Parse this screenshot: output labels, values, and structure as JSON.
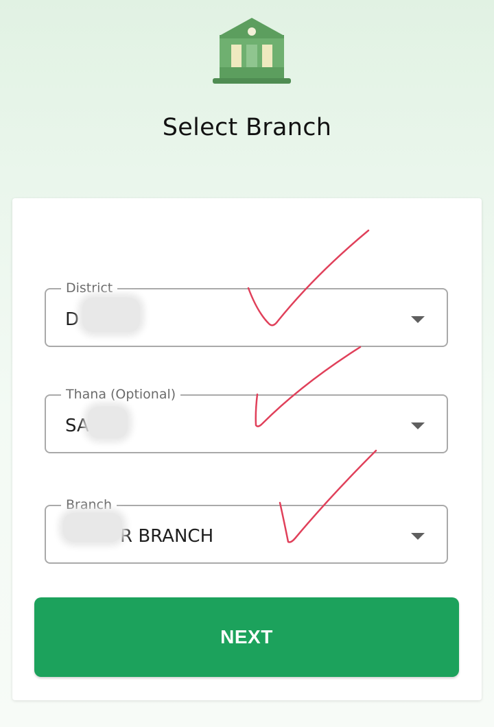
{
  "header": {
    "icon": "bank-icon",
    "title": "Select Branch"
  },
  "form": {
    "district": {
      "label": "District",
      "value": "D"
    },
    "thana": {
      "label": "Thana (Optional)",
      "value": "SA"
    },
    "branch": {
      "label": "Branch",
      "value": "R BRANCH"
    }
  },
  "next_label": "NEXT",
  "colors": {
    "accent": "#1ca25c",
    "bank_icon": "#5f9f5f",
    "annotation": "#e0405a"
  }
}
